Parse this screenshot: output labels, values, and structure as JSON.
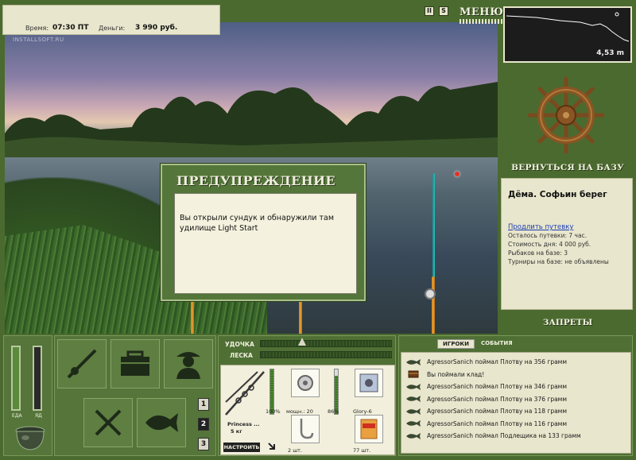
{
  "status": {
    "time_label": "Время:",
    "time_value": "07:30 ПТ",
    "money_label": "Деньги:",
    "money_value": "3 990 руб."
  },
  "watermark": "INSTALLSOFT.RU",
  "top": {
    "pause_icon": "pause-icon",
    "sound_icon": "sound-icon",
    "menu_label": "МЕНЮ"
  },
  "depth": {
    "value": "4,53 m"
  },
  "right": {
    "back_to_base": "ВЕРНУТЬСЯ НА БАЗУ",
    "place_name": "Дёма. Софьин берег",
    "extend_link": "Продлить путевку",
    "info": [
      "Осталось путевки: 7 час.",
      "Стоимость дня: 4 000 руб.",
      "Рыбаков на базе: 3",
      "Турниры на базе: не объявлены"
    ],
    "bans": "ЗАПРЕТЫ"
  },
  "needs": {
    "food_label": "ЕДА",
    "poison_label": "ЯД",
    "food_level": 1.0,
    "poison_level": 0.0
  },
  "icons": [
    "rod-icon",
    "tackle-box-icon",
    "angler-icon",
    "cutlery-icon",
    "fish-icon"
  ],
  "pages": [
    "1",
    "2",
    "3"
  ],
  "tackle": {
    "rod_label": "УДОЧКА",
    "line_label": "ЛЕСКА",
    "rod_name": "Princess ...",
    "rod_weight": "5 кг",
    "rod_percent": "100%",
    "reel_power": "мощн.: 20",
    "reel_percent": "86%",
    "lure_name": "Glory-6",
    "hook_count": "2 шт.",
    "bait_count": "77 шт.",
    "tune_button": "НАСТРОИТЬ"
  },
  "events": {
    "tab_players": "ИГРОКИ",
    "tab_events": "СОБЫТИЯ",
    "items": [
      {
        "icon": "fish-icon",
        "text": "AgressorSanich поймал Плотву на 356 грамм"
      },
      {
        "icon": "chest-icon",
        "text": "Вы поймали клад!"
      },
      {
        "icon": "fish-icon",
        "text": "AgressorSanich поймал Плотву на 346 грамм"
      },
      {
        "icon": "fish-icon",
        "text": "AgressorSanich поймал Плотву на 376 грамм"
      },
      {
        "icon": "fish-icon",
        "text": "AgressorSanich поймал Плотву на 118 грамм"
      },
      {
        "icon": "fish-icon",
        "text": "AgressorSanich поймал Плотву на 116 грамм"
      },
      {
        "icon": "fish-icon",
        "text": "AgressorSanich поймал Подлещика на 133 грамм"
      }
    ]
  },
  "dialog": {
    "title": "ПРЕДУПРЕЖДЕНИЕ",
    "message": "Вы открыли сундук и обнаружили там удилище Light Start"
  },
  "colors": {
    "panel": "#55753a",
    "paper": "#e8e6cc",
    "text_light": "#f0f0e0",
    "float": "#e83020",
    "rod": "#f0a030"
  }
}
